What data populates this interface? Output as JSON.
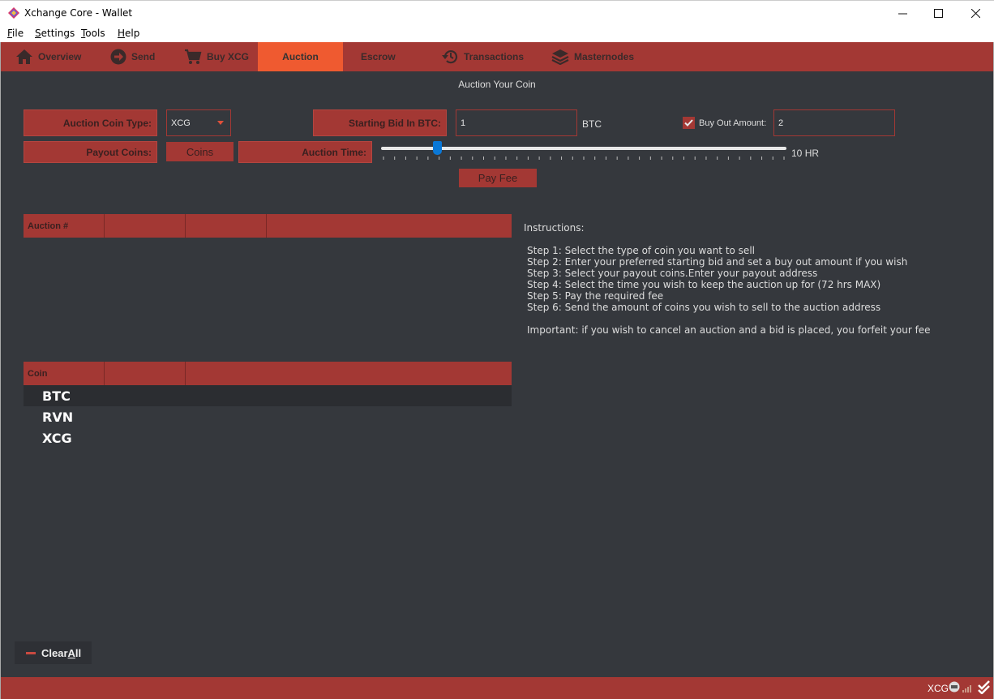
{
  "window": {
    "title": "Xchange Core - Wallet"
  },
  "menu": {
    "file": {
      "first": "F",
      "rest": "ile"
    },
    "settings": {
      "first": "S",
      "rest": "ettings"
    },
    "tools": {
      "first": "T",
      "rest": "ools"
    },
    "help": {
      "first": "H",
      "rest": "elp"
    }
  },
  "tabs": {
    "overview": "Overview",
    "send": "Send",
    "buy": "Buy XCG",
    "auction": "Auction",
    "escrow": "Escrow",
    "transactions": "Transactions",
    "masternodes": "Masternodes"
  },
  "auction": {
    "title": "Auction Your Coin",
    "coin_type_label": "Auction Coin Type:",
    "coin_type_value": "XCG",
    "starting_bid_label": "Starting Bid In BTC:",
    "starting_bid_value": "1",
    "starting_bid_unit": "BTC",
    "buyout_label": "Buy Out Amount:",
    "buyout_value": "2",
    "buyout_checked": true,
    "payout_label": "Payout Coins:",
    "coins_button": "Coins",
    "time_label": "Auction Time:",
    "time_value": "10",
    "time_unit": "HR",
    "time_max": 72,
    "pay_fee_button": "Pay Fee"
  },
  "auction_table": {
    "headers": [
      "Auction #",
      "",
      "",
      ""
    ]
  },
  "coin_table": {
    "headers": [
      "Coin",
      "",
      ""
    ],
    "rows": [
      "BTC",
      "RVN",
      "XCG"
    ]
  },
  "instructions": {
    "title": "Instructions:",
    "steps": [
      "Step 1: Select the type of coin you want to sell",
      "Step 2: Enter your preferred starting bid and set a buy out amount if you wish",
      "Step 3: Select your payout coins.Enter your payout address",
      "Step 4: Select the time you wish to keep the auction up for (72 hrs MAX)",
      "Step 5: Pay the required fee",
      "Step 6: Send the amount of coins you wish to sell to the auction address"
    ],
    "important": "Important: if you wish to cancel an auction and a bid is placed, you forfeit your fee"
  },
  "clear_all": {
    "first": "Clear ",
    "underlined": "A",
    "rest": "ll"
  },
  "status": {
    "unit": "XCG"
  },
  "colors": {
    "accent": "#a33834",
    "active_tab": "#ef5a30",
    "background": "#35383d"
  }
}
